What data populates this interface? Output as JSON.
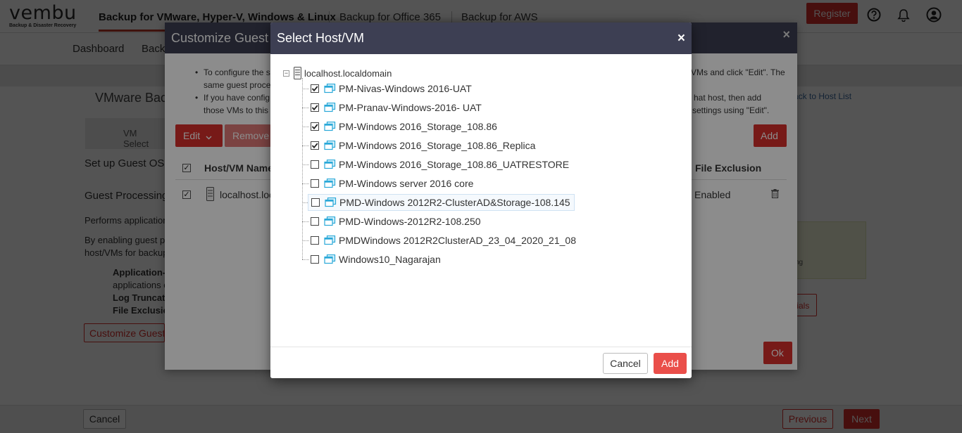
{
  "brand": {
    "name": "vembu",
    "tagline": "Backup & Disaster Recovery"
  },
  "product_tabs": [
    {
      "label": "Backup for VMware, Hyper-V, Windows & Linux"
    },
    {
      "label": "Backup for Office 365"
    },
    {
      "label": "Backup for AWS"
    }
  ],
  "header_actions": {
    "register_label": "Register"
  },
  "nav": {
    "items": [
      {
        "label": "Dashboard"
      },
      {
        "label": "Back"
      }
    ]
  },
  "page": {
    "title": "VMware Bac",
    "back_link": "ack to Host List",
    "step_tab": "VM Select",
    "setup_text": "Set up Guest OS P",
    "guest_processing": "Guest Processing",
    "performs_text": "Performs application",
    "enabling_text_1": "By enabling guest pr",
    "enabling_text_2": "host/VMs for backup",
    "bullet_1": "Application-a",
    "bullet_1_cont": "applications c",
    "bullet_2": "Log Truncatio",
    "bullet_3": "File Exclusion",
    "customize_button": "Customize Guest",
    "info_box_text": "ng",
    "credentials_button": "tials"
  },
  "footer": {
    "cancel_label": "Cancel",
    "previous_label": "Previous",
    "next_label": "Next"
  },
  "customize_dialog": {
    "title": "Customize Guest",
    "close_glyph": "×",
    "info_line_1a": "To configure the s",
    "info_line_1b": "VMs and click \"Edit\". The",
    "info_line_1c": "same guest proce",
    "info_line_2a": "If you have config",
    "info_line_2b": "hat host, then add",
    "info_line_2c": "those VMs to this",
    "info_line_2d": "settings using \"Edit\".",
    "edit_label": "Edit",
    "remove_label": "Remove",
    "add_label": "Add",
    "table": {
      "col_host": "Host/VM Name",
      "col_file_exclusion": "File Exclusion",
      "row_host": "localhost.loc",
      "row_file_exclusion": "Enabled"
    },
    "ok_label": "Ok"
  },
  "select_dialog": {
    "title": "Select Host/VM",
    "close_glyph": "×",
    "root": {
      "label": "localhost.localdomain",
      "expander": "−"
    },
    "vms": [
      {
        "label": "PM-Nivas-Windows 2016-UAT",
        "checked": true
      },
      {
        "label": "PM-Pranav-Windows-2016- UAT",
        "checked": true
      },
      {
        "label": "PM-Windows 2016_Storage_108.86",
        "checked": true
      },
      {
        "label": "PM-Windows 2016_Storage_108.86_Replica",
        "checked": true
      },
      {
        "label": "PM-Windows 2016_Storage_108.86_UATRESTORE",
        "checked": false
      },
      {
        "label": "PM-Windows server 2016 core",
        "checked": false
      },
      {
        "label": "PMD-Windows 2012R2-ClusterAD&Storage-108.145",
        "checked": false,
        "hovered": true
      },
      {
        "label": "PMD-Windows-2012R2-108.250",
        "checked": false
      },
      {
        "label": "PMDWindows 2012R2ClusterAD_23_04_2020_21_08",
        "checked": false
      },
      {
        "label": "Windows10_Nagarajan",
        "checked": false
      }
    ],
    "cancel_label": "Cancel",
    "add_label": "Add"
  },
  "colors": {
    "brand_red": "#d9302d",
    "dialog_header": "#3d3f53",
    "vm_icon": "#29a8d8"
  }
}
